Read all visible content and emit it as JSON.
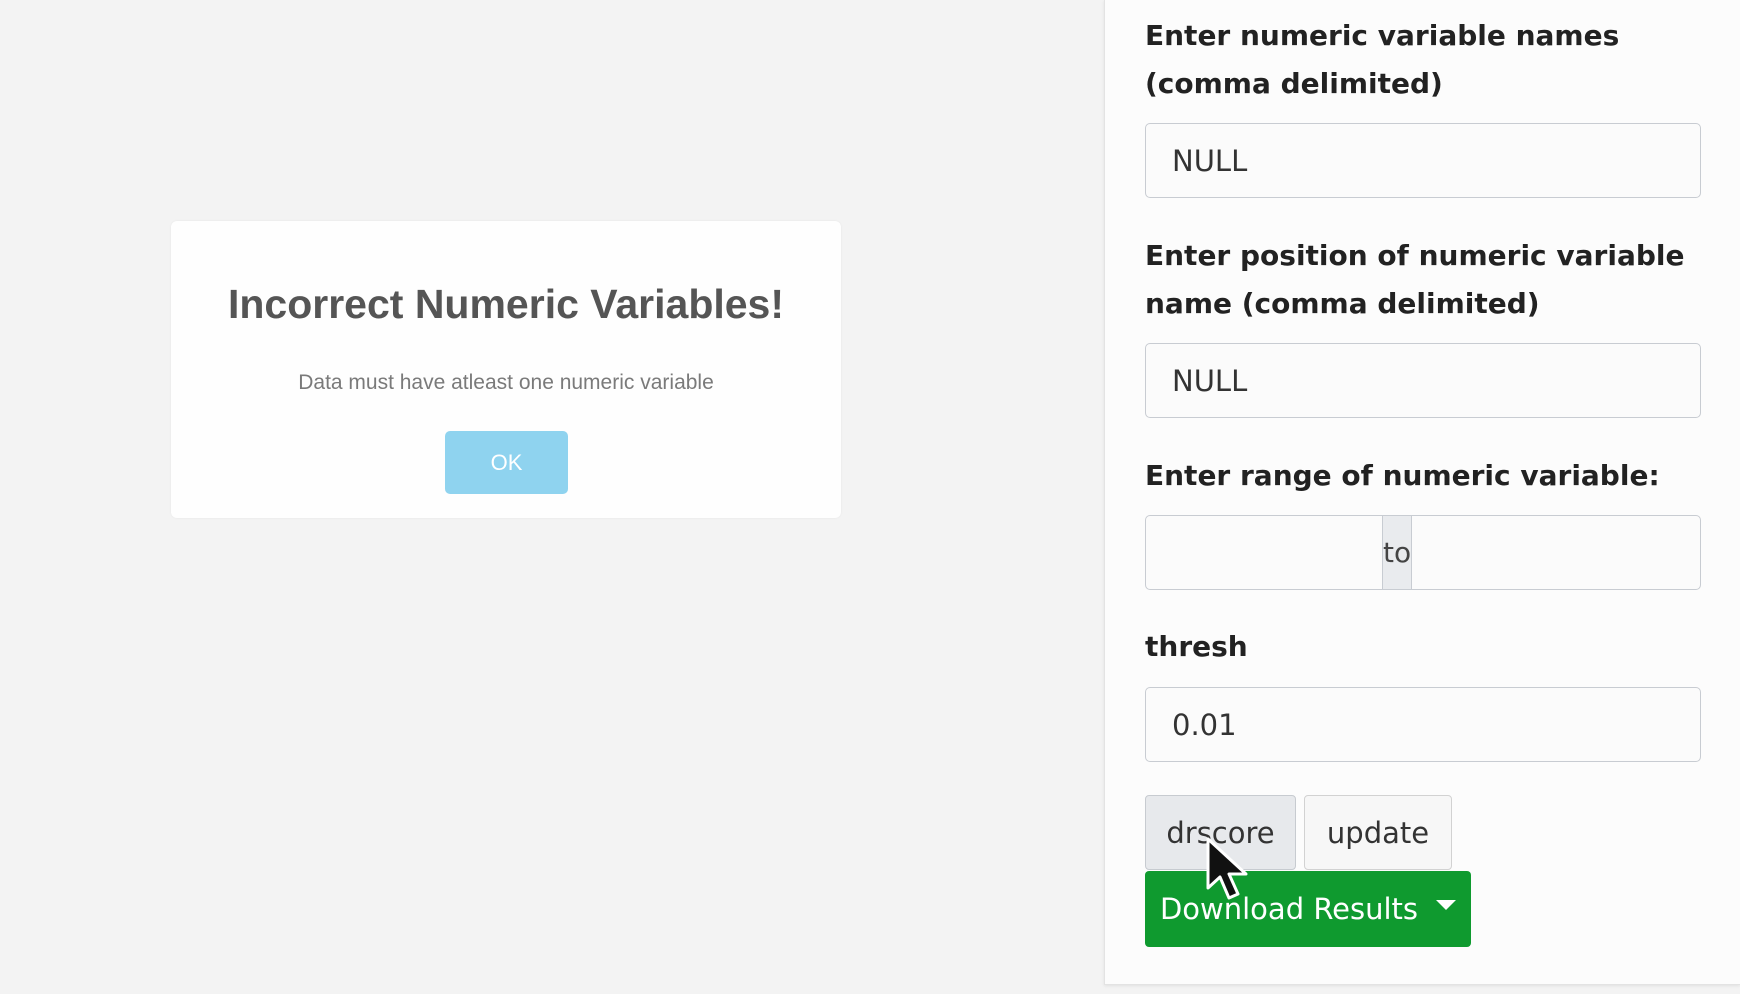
{
  "modal": {
    "title": "Incorrect Numeric Variables!",
    "message": "Data must have atleast one numeric variable",
    "ok_label": "OK"
  },
  "sidebar": {
    "numeric_names": {
      "label": "Enter numeric variable names (comma delimited)",
      "value": "NULL"
    },
    "numeric_position": {
      "label": "Enter position of numeric variable name (comma delimited)",
      "value": "NULL"
    },
    "numeric_range": {
      "label": "Enter range of numeric variable:",
      "from_value": "",
      "separator": "to",
      "to_value": ""
    },
    "thresh": {
      "label": "thresh",
      "value": "0.01"
    },
    "buttons": {
      "drscore_label": "drscore",
      "update_label": "update",
      "download_label": "Download Results"
    }
  },
  "colors": {
    "download_button": "#0f9a2f",
    "ok_button": "#8fd3ef"
  },
  "icons": {
    "dropdown": "caret-down-icon",
    "cursor": "mouse-pointer-icon"
  }
}
